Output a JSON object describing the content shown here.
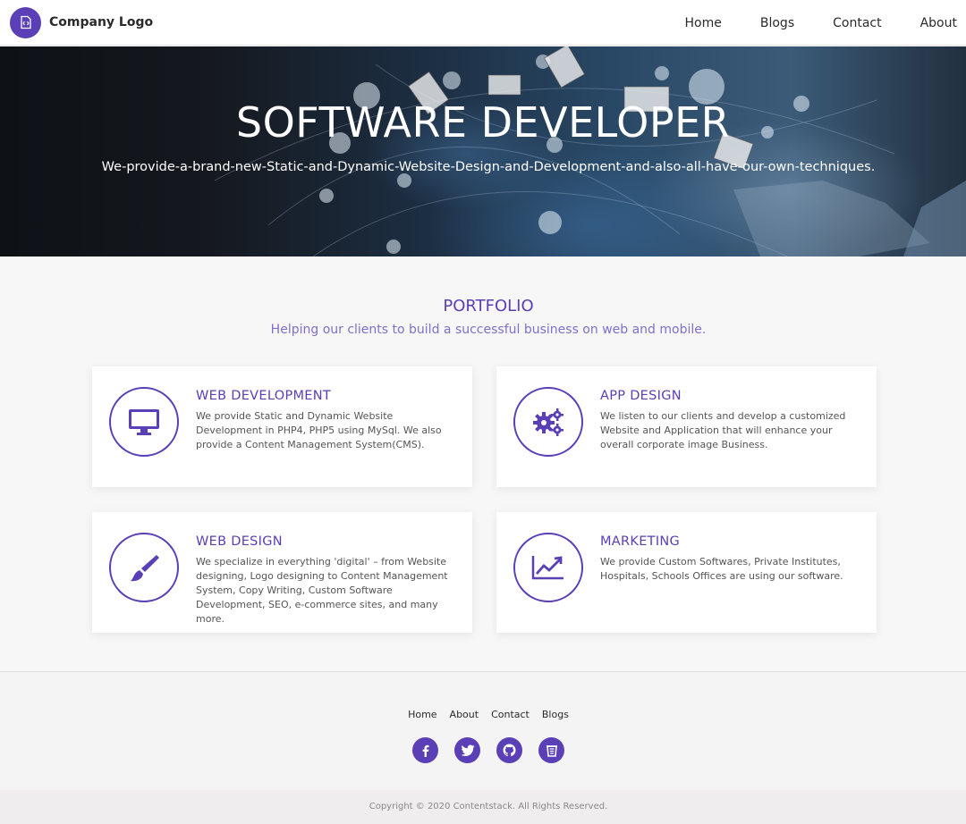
{
  "header": {
    "logo_text": "Company Logo",
    "nav": [
      {
        "label": "Home"
      },
      {
        "label": "Blogs"
      },
      {
        "label": "Contact"
      },
      {
        "label": "About"
      }
    ]
  },
  "hero": {
    "title": "SOFTWARE DEVELOPER",
    "subtitle": "We-provide-a-brand-new-Static-and-Dynamic-Website-Design-and-Development-and-also-all-have-our-own-techniques."
  },
  "portfolio": {
    "title": "PORTFOLIO",
    "subtitle": "Helping our clients to build a successful business on web and mobile.",
    "cards": [
      {
        "title": "WEB DEVELOPMENT",
        "text": "We provide Static and Dynamic Website Development in PHP4, PHP5 using MySql. We also provide a Content Management System(CMS).",
        "icon": "monitor-icon"
      },
      {
        "title": "APP DESIGN",
        "text": "We listen to our clients and develop a customized Website and Application that will enhance your overall corporate image Business.",
        "icon": "gears-icon"
      },
      {
        "title": "WEB DESIGN",
        "text": "We specialize in everything 'digital' – from Website designing, Logo designing to Content Management System, Copy Writing, Custom Software Development, SEO, e-commerce sites, and many more.",
        "icon": "paint-brush-icon"
      },
      {
        "title": "MARKETING",
        "text": "We provide Custom Softwares, Private Institutes, Hospitals, Schools Offices are using our software.",
        "icon": "chart-line-icon"
      }
    ]
  },
  "footer": {
    "links": [
      {
        "label": "Home"
      },
      {
        "label": "About"
      },
      {
        "label": "Contact"
      },
      {
        "label": "Blogs"
      }
    ],
    "socials": [
      "facebook-icon",
      "twitter-icon",
      "github-icon",
      "stackoverflow-icon"
    ],
    "copyright": "Copyright © 2020 Contentstack. All Rights Reserved."
  },
  "colors": {
    "accent": "#5a3fb6",
    "accent_light": "#8070c8",
    "background": "#f7f7f7"
  }
}
